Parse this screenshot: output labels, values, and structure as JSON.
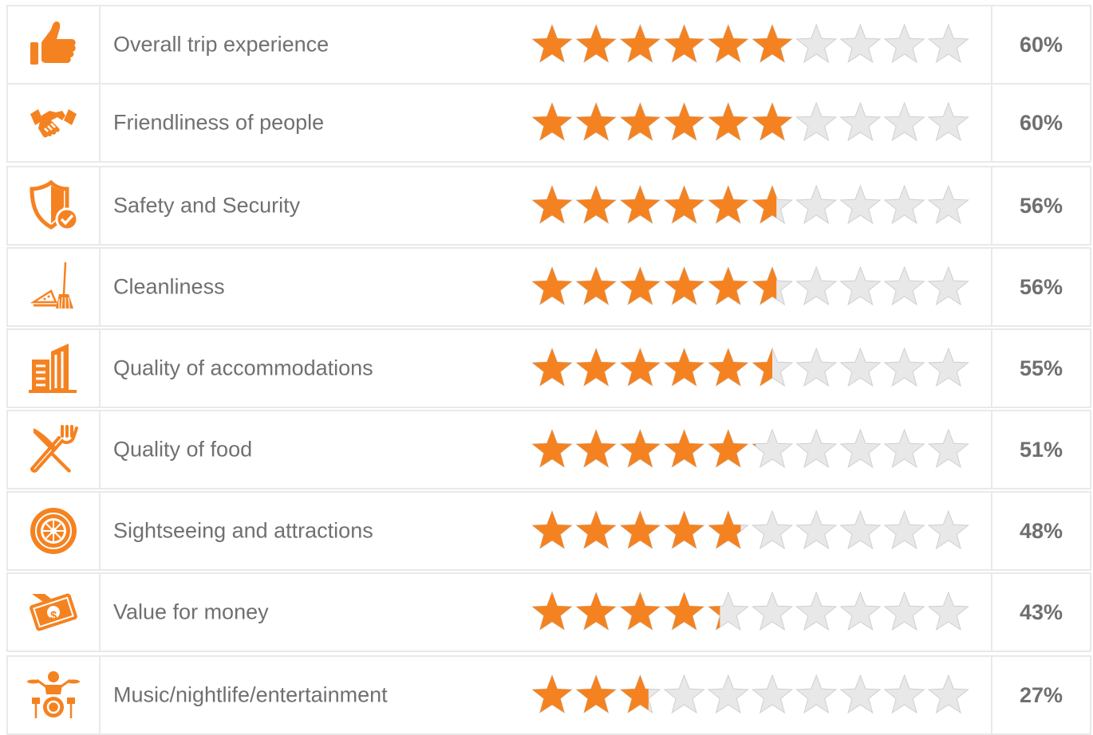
{
  "chart_data": {
    "type": "bar",
    "max_stars": 10,
    "star_colors": {
      "filled": "#f58220",
      "empty": "#e8e8e8",
      "empty_stroke": "#cfcfcf"
    },
    "icon_color": "#f58220",
    "categories": [
      "Overall trip experience",
      "Friendliness of people",
      "Safety and Security",
      "Cleanliness",
      "Quality of accommodations",
      "Quality of food",
      "Sightseeing and attractions",
      "Value for money",
      "Music/nightlife/entertainment"
    ],
    "values": [
      60,
      60,
      56,
      56,
      55,
      51,
      48,
      43,
      27
    ],
    "value_labels": [
      "60%",
      "60%",
      "56%",
      "56%",
      "55%",
      "51%",
      "48%",
      "43%",
      "27%"
    ],
    "icons": [
      "thumbs-up-icon",
      "handshake-icon",
      "shield-check-icon",
      "broom-dustpan-icon",
      "building-icon",
      "fork-knife-icon",
      "roulette-wheel-icon",
      "money-hand-icon",
      "drummer-icon"
    ]
  }
}
